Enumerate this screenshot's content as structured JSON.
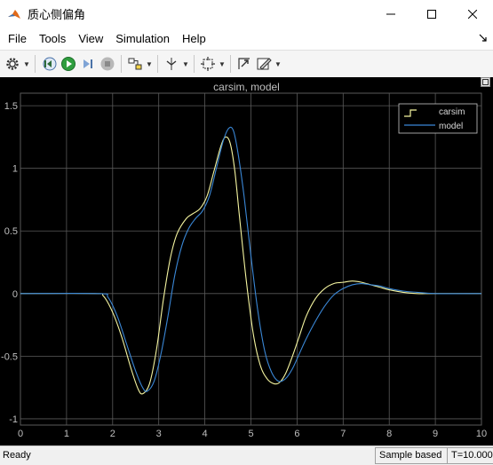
{
  "window": {
    "title": "质心侧偏角",
    "controls": [
      "minimize",
      "maximize",
      "close"
    ]
  },
  "menu": {
    "items": [
      "File",
      "Tools",
      "View",
      "Simulation",
      "Help"
    ]
  },
  "toolbar": {
    "buttons": [
      {
        "icon": "gear-icon",
        "dropdown": true
      },
      {
        "icon": "step-back-icon"
      },
      {
        "icon": "run-icon"
      },
      {
        "icon": "step-forward-icon"
      },
      {
        "icon": "stop-icon"
      },
      {
        "icon": "highlight-model-icon",
        "dropdown": true
      },
      {
        "icon": "cursor-measurements-icon",
        "dropdown": true
      },
      {
        "icon": "zoom-icon",
        "dropdown": true
      },
      {
        "icon": "autoscale-icon"
      },
      {
        "icon": "style-icon",
        "dropdown": true
      }
    ]
  },
  "colors": {
    "background": "#000000",
    "grid": "#5a5a5a",
    "carsim": "#f5f5a0",
    "model": "#3a87d6",
    "tick_text": "#bfbfbf"
  },
  "chart_data": {
    "type": "line",
    "title": "carsim, model",
    "xlim": [
      0,
      10
    ],
    "ylim": [
      -1.05,
      1.6
    ],
    "xticks": [
      0,
      1,
      2,
      3,
      4,
      5,
      6,
      7,
      8,
      9,
      10
    ],
    "yticks": [
      -1,
      -0.5,
      0,
      0.5,
      1,
      1.5
    ],
    "grid": true,
    "legend_position": "top-right",
    "series": [
      {
        "name": "carsim",
        "x": [
          0,
          1.6,
          1.8,
          2.0,
          2.2,
          2.4,
          2.55,
          2.65,
          2.8,
          2.95,
          3.1,
          3.25,
          3.4,
          3.6,
          3.75,
          3.9,
          4.05,
          4.2,
          4.35,
          4.45,
          4.55,
          4.65,
          4.75,
          4.9,
          5.05,
          5.2,
          5.35,
          5.5,
          5.62,
          5.75,
          5.9,
          6.05,
          6.2,
          6.4,
          6.6,
          6.8,
          7.0,
          7.2,
          7.4,
          7.6,
          7.8,
          8.0,
          8.3,
          8.6,
          9.0,
          10
        ],
        "values": [
          0,
          0,
          -0.02,
          -0.15,
          -0.35,
          -0.6,
          -0.76,
          -0.8,
          -0.72,
          -0.45,
          -0.05,
          0.28,
          0.48,
          0.6,
          0.64,
          0.68,
          0.78,
          0.98,
          1.18,
          1.25,
          1.2,
          0.98,
          0.62,
          0.1,
          -0.32,
          -0.57,
          -0.68,
          -0.72,
          -0.71,
          -0.64,
          -0.5,
          -0.34,
          -0.18,
          -0.04,
          0.04,
          0.08,
          0.09,
          0.1,
          0.09,
          0.07,
          0.05,
          0.03,
          0.01,
          0.0,
          0.0,
          0.0
        ]
      },
      {
        "name": "model",
        "x": [
          0,
          1.7,
          1.9,
          2.1,
          2.3,
          2.5,
          2.65,
          2.75,
          2.9,
          3.05,
          3.2,
          3.35,
          3.5,
          3.65,
          3.8,
          3.95,
          4.1,
          4.25,
          4.4,
          4.52,
          4.62,
          4.72,
          4.85,
          5.0,
          5.15,
          5.3,
          5.45,
          5.6,
          5.75,
          5.9,
          6.05,
          6.2,
          6.4,
          6.6,
          6.8,
          7.0,
          7.2,
          7.4,
          7.6,
          7.8,
          8.0,
          8.3,
          8.6,
          9.0,
          10
        ],
        "values": [
          0,
          0,
          -0.03,
          -0.18,
          -0.4,
          -0.62,
          -0.75,
          -0.78,
          -0.7,
          -0.48,
          -0.18,
          0.15,
          0.38,
          0.52,
          0.6,
          0.66,
          0.78,
          1.0,
          1.22,
          1.32,
          1.3,
          1.12,
          0.78,
          0.3,
          -0.14,
          -0.46,
          -0.63,
          -0.7,
          -0.68,
          -0.6,
          -0.48,
          -0.36,
          -0.22,
          -0.1,
          -0.01,
          0.04,
          0.07,
          0.08,
          0.07,
          0.06,
          0.04,
          0.02,
          0.01,
          0.0,
          0.0
        ]
      }
    ]
  },
  "status": {
    "ready": "Ready",
    "sample_mode": "Sample based",
    "time": "T=10.000"
  }
}
